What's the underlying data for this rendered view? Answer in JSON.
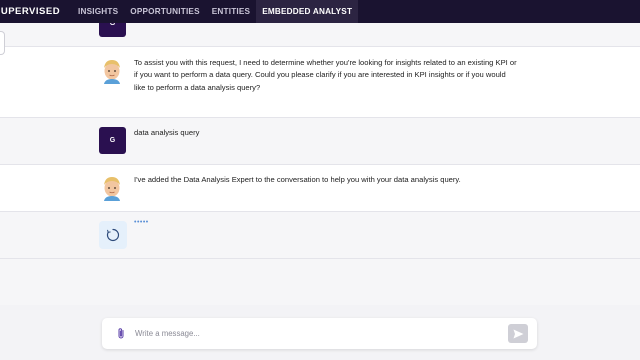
{
  "nav": {
    "brand": "SUPERVISED",
    "tabs": [
      {
        "label": "INSIGHTS",
        "active": false
      },
      {
        "label": "OPPORTUNITIES",
        "active": false
      },
      {
        "label": "ENTITIES",
        "active": false
      },
      {
        "label": "EMBEDDED ANALYST",
        "active": true
      }
    ]
  },
  "messages": [
    {
      "role": "user",
      "avatar_initial": "G",
      "text": ""
    },
    {
      "role": "assistant",
      "avatar_icon": "memoji-avatar-icon",
      "text": "To assist you with this request, I need to determine whether you're looking for insights related to an existing KPI or if you want to perform a data query. Could you please clarify if you are interested in KPI insights or if you would like to perform a data analysis query?"
    },
    {
      "role": "user",
      "avatar_initial": "G",
      "text": "data analysis query"
    },
    {
      "role": "assistant",
      "avatar_icon": "memoji-avatar-icon",
      "text": "I've added the Data Analysis Expert to the conversation to help you with your data analysis query."
    },
    {
      "role": "loading",
      "avatar_icon": "loading-spinner-icon",
      "text": "•••••"
    }
  ],
  "composer": {
    "placeholder": "Write a message...",
    "value": "",
    "attach_icon": "paperclip-icon",
    "send_icon": "send-icon"
  },
  "colors": {
    "nav_bg": "#1a1330",
    "user_avatar": "#2a1050",
    "loading_bg": "#e5f0fb",
    "dots": "#5a8fd6"
  }
}
